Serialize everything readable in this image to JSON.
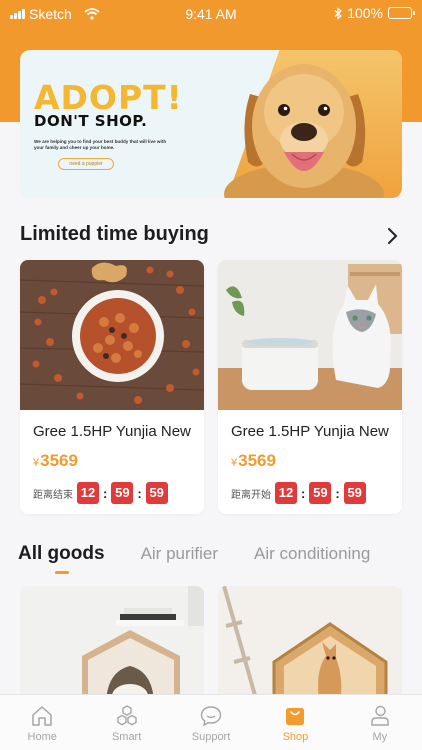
{
  "status_bar": {
    "carrier": "Sketch",
    "time": "9:41 AM",
    "battery": "100%"
  },
  "banner": {
    "headline": "ADOPT!",
    "subline": "DON'T SHOP.",
    "description": "We are helping you to find your best buddy that will live with your family and cheer up your home.",
    "cta": "need a puppier"
  },
  "limited": {
    "title": "Limited time buying",
    "products": [
      {
        "name": "Gree 1.5HP Yunjia New",
        "currency": "¥",
        "price": "3569",
        "timer_label": "距离结束",
        "hours": "12",
        "minutes": "59",
        "seconds": "59"
      },
      {
        "name": "Gree 1.5HP Yunjia New",
        "currency": "¥",
        "price": "3569",
        "timer_label": "距离开始",
        "hours": "12",
        "minutes": "59",
        "seconds": "59"
      }
    ]
  },
  "goods_tabs": [
    "All goods",
    "Air purifier",
    "Air conditioning"
  ],
  "tabbar": {
    "items": [
      {
        "label": "Home",
        "icon": "home-icon"
      },
      {
        "label": "Smart",
        "icon": "smart-icon"
      },
      {
        "label": "Support",
        "icon": "support-icon"
      },
      {
        "label": "Shop",
        "icon": "shop-icon"
      },
      {
        "label": "My",
        "icon": "user-icon"
      }
    ],
    "active": "Shop"
  },
  "colors": {
    "accent": "#f29b2e",
    "header": "#f2992e",
    "timer": "#e03a3a",
    "headline": "#f5b731"
  }
}
